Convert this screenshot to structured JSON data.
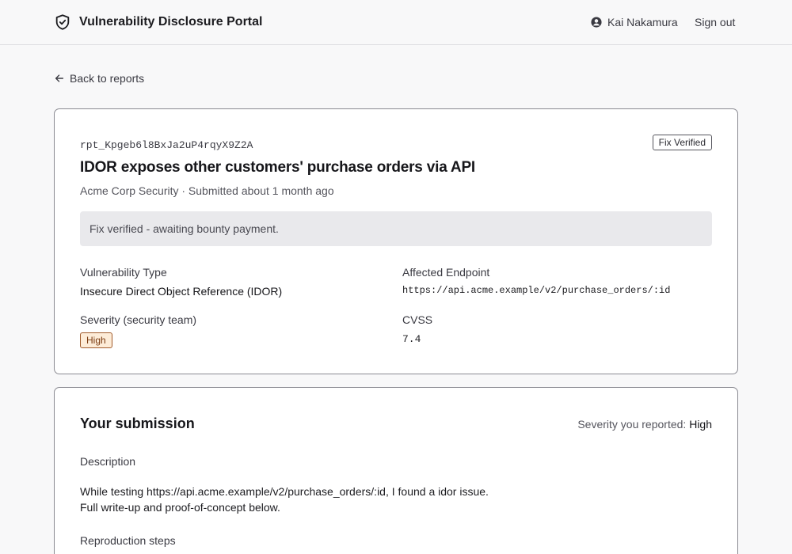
{
  "header": {
    "title": "Vulnerability Disclosure Portal",
    "user_name": "Kai Nakamura",
    "sign_out": "Sign out"
  },
  "nav": {
    "back_label": "Back to reports"
  },
  "report": {
    "id": "rpt_Kpgeb6l8BxJa2uP4rqyX9Z2A",
    "status": "Fix Verified",
    "title": "IDOR exposes other customers' purchase orders via API",
    "meta": "Acme Corp Security · Submitted about 1 month ago",
    "notice": "Fix verified - awaiting bounty payment.",
    "fields": {
      "vuln_type_label": "Vulnerability Type",
      "vuln_type_value": "Insecure Direct Object Reference (IDOR)",
      "endpoint_label": "Affected Endpoint",
      "endpoint_value": "https://api.acme.example/v2/purchase_orders/:id",
      "severity_label": "Severity (security team)",
      "severity_value": "High",
      "cvss_label": "CVSS",
      "cvss_value": "7.4"
    }
  },
  "submission": {
    "title": "Your submission",
    "severity_reported_label": "Severity you reported:",
    "severity_reported_value": "High",
    "description_label": "Description",
    "description_line1": "While testing https://api.acme.example/v2/purchase_orders/:id, I found a idor issue.",
    "description_line2": "Full write-up and proof-of-concept below.",
    "repro_label": "Reproduction steps"
  },
  "colors": {
    "severity_badge_bg": "#fdecd8",
    "severity_badge_border": "#a05a2a",
    "notice_bg": "#e9e9ec"
  },
  "icons": {
    "brand": "shield-check-icon",
    "user": "user-circle-icon",
    "back": "arrow-left-icon"
  }
}
